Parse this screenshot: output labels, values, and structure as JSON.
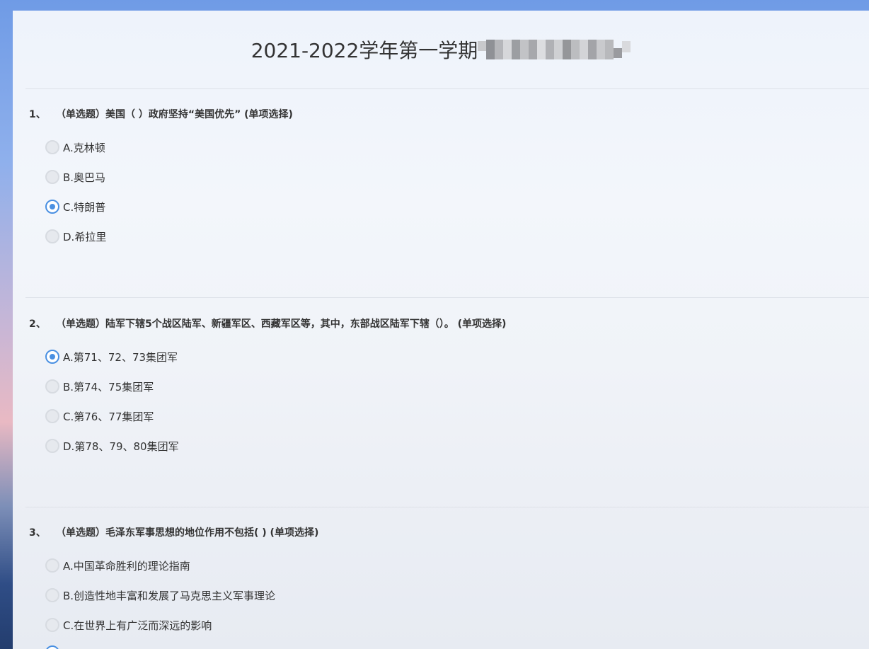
{
  "exam": {
    "title": "2021-2022学年第一学期"
  },
  "questions": [
    {
      "number": "1、",
      "text": "（单选题）美国（ ）政府坚持“美国优先” (单项选择)",
      "options": [
        {
          "label": "A.克林顿",
          "selected": false
        },
        {
          "label": "B.奥巴马",
          "selected": false
        },
        {
          "label": "C.特朗普",
          "selected": true
        },
        {
          "label": "D.希拉里",
          "selected": false
        }
      ]
    },
    {
      "number": "2、",
      "text": "（单选题）陆军下辖5个战区陆军、新疆军区、西藏军区等，其中，东部战区陆军下辖（）。 (单项选择)",
      "options": [
        {
          "label": "A.第71、72、73集团军",
          "selected": true
        },
        {
          "label": "B.第74、75集团军",
          "selected": false
        },
        {
          "label": "C.第76、77集团军",
          "selected": false
        },
        {
          "label": "D.第78、79、80集团军",
          "selected": false
        }
      ]
    },
    {
      "number": "3、",
      "text": "（单选题）毛泽东军事思想的地位作用不包括( ) (单项选择)",
      "options": [
        {
          "label": "A.中国革命胜利的理论指南",
          "selected": false
        },
        {
          "label": "B.创造性地丰富和发展了马克思主义军事理论",
          "selected": false
        },
        {
          "label": "C.在世界上有广泛而深远的影响",
          "selected": false
        }
      ]
    }
  ],
  "colors": {
    "accent": "#4a90e2",
    "text": "#333333",
    "divider": "#dde1e8"
  }
}
